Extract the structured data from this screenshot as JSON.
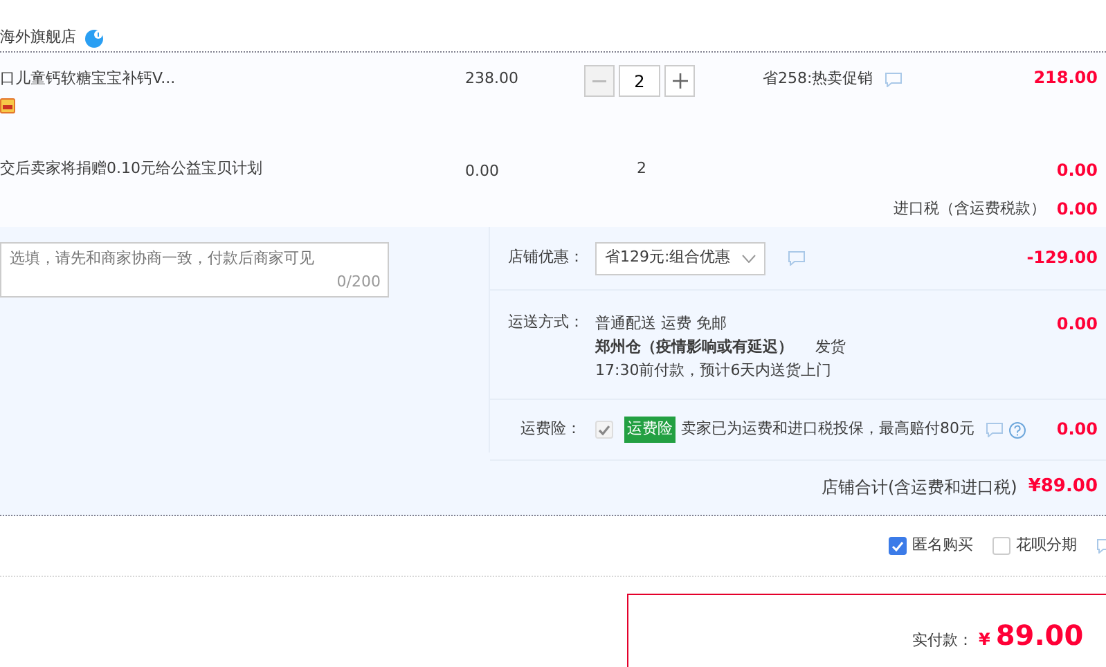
{
  "store": {
    "name": "海外旗舰店"
  },
  "items": [
    {
      "kind": "product",
      "title": "口儿童钙软糖宝宝补钙V...",
      "price": "238.00",
      "stepper": {
        "value": "2",
        "decrease_disabled": true
      },
      "promotion": "省258:热卖促销",
      "subtotal": "218.00"
    },
    {
      "kind": "donation",
      "title": "交后卖家将捐赠0.10元给公益宝贝计划",
      "price": "0.00",
      "quantity": "2",
      "subtotal": "0.00"
    }
  ],
  "import_tax": {
    "label": "进口税（含运费税款）",
    "amount": "0.00"
  },
  "message": {
    "placeholder": "选填，请先和商家协商一致，付款后商家可见",
    "counter": "0/200"
  },
  "coupon": {
    "label": "店铺优惠：",
    "value": "省129元:组合优惠",
    "amount": "-129.00"
  },
  "shipping": {
    "label": "运送方式：",
    "method": "普通配送 运费 免邮",
    "warehouse": "郑州仓（疫情影响或有延迟）",
    "dispatch": "发货",
    "eta": "17:30前付款，预计6天内送货上门",
    "amount": "0.00"
  },
  "insurance": {
    "label": "运费险：",
    "checked": true,
    "disabled": true,
    "tag": "运费险",
    "text": "卖家已为运费和进口税投保，最高赔付80元",
    "amount": "0.00"
  },
  "store_total": {
    "label": "店铺合计(含运费和进口税)",
    "amount": "¥89.00"
  },
  "options": [
    {
      "label": "匿名购买",
      "checked": true
    },
    {
      "label": "花呗分期",
      "checked": false
    }
  ],
  "payment": {
    "label": "实付款：",
    "currency": "¥",
    "amount": "89.00"
  }
}
